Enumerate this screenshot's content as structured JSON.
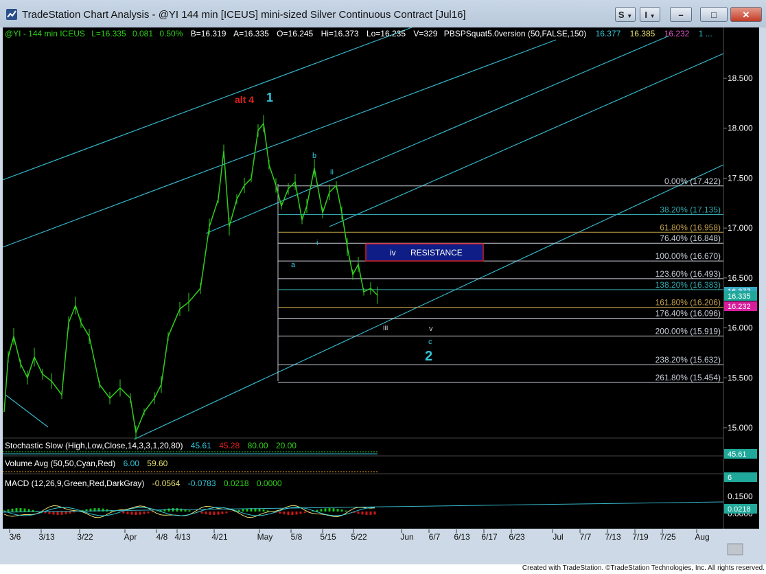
{
  "window": {
    "title": "TradeStation Chart Analysis - @YI 144 min [ICEUS] mini-sized Silver Continuous Contract [Jul16]",
    "buttons": {
      "s": "S",
      "i": "I"
    }
  },
  "header": {
    "symbol": "@YI - 144 min ICEUS",
    "last": "L=16.335",
    "change": "0.081",
    "pct": "0.50%",
    "bid": "B=16.319",
    "ask": "A=16.335",
    "open": "O=16.245",
    "high": "Hi=16.373",
    "low": "Lo=16.235",
    "volume": "V=329",
    "indicator": "PBSPSquat5.0version (50,FALSE,150)",
    "ind_v1": "16.377",
    "ind_v2": "16.385",
    "ind_v3": "16.232",
    "ind_v4": "1 ..."
  },
  "colors": {
    "price": "#2fd01a",
    "channel": "#35b6c8",
    "fib": "#c8cdd8",
    "resistance_fill": "#0f1d86",
    "resistance_border": "#d51d1d",
    "macd_hist_pos": "#19c219",
    "macd_hist_neg": "#d01717",
    "last_price_tag": "#20a89a",
    "pbs_tag": "#d61d9c"
  },
  "price_axis": [
    "18.500",
    "18.000",
    "17.500",
    "17.000",
    "16.500",
    "16.000",
    "15.500",
    "15.000"
  ],
  "price_tags": {
    "last": "16.335",
    "pbs": "16.232",
    "hidden": "16.377"
  },
  "fib_levels": [
    {
      "label": "0.00% (17.422)",
      "price": 17.422,
      "color": "#c8cdd8"
    },
    {
      "label": "38.20% (17.135)",
      "price": 17.135,
      "color": "#32a8ad"
    },
    {
      "label": "61.80% (16.958)",
      "price": 16.958,
      "color": "#c2a04a"
    },
    {
      "label": "76.40% (16.848)",
      "price": 16.848,
      "color": "#c8cdd8"
    },
    {
      "label": "100.00% (16.670)",
      "price": 16.67,
      "color": "#c8cdd8"
    },
    {
      "label": "123.60% (16.493)",
      "price": 16.493,
      "color": "#c8cdd8"
    },
    {
      "label": "138.20% (16.383)",
      "price": 16.383,
      "color": "#32a8ad"
    },
    {
      "label": "161.80% (16.206)",
      "price": 16.206,
      "color": "#c2a04a"
    },
    {
      "label": "176.40% (16.096)",
      "price": 16.096,
      "color": "#c8cdd8"
    },
    {
      "label": "200.00% (15.919)",
      "price": 15.919,
      "color": "#c8cdd8"
    },
    {
      "label": "238.20% (15.632)",
      "price": 15.632,
      "color": "#c8cdd8"
    },
    {
      "label": "261.80% (15.454)",
      "price": 15.454,
      "color": "#c8cdd8"
    }
  ],
  "resistance": {
    "wave": "iv",
    "label": "RESISTANCE"
  },
  "wave_labels": {
    "alt4": "alt 4",
    "one": "1",
    "a": "a",
    "b": "b",
    "i": "i",
    "ii": "ii",
    "iii": "iii",
    "v": "v",
    "c": "c",
    "two": "2"
  },
  "stochastic": {
    "label": "Stochastic Slow (High,Low,Close,14,3,3,1,20,80)",
    "v1": "45.61",
    "v2": "45.28",
    "v3": "80.00",
    "v4": "20.00",
    "tag": "45.61"
  },
  "volume_avg": {
    "label": "Volume Avg (50,50,Cyan,Red)",
    "v1": "6.00",
    "v2": "59.60",
    "tag": "6"
  },
  "macd": {
    "label": "MACD (12,26,9,Green,Red,DarkGray)",
    "v1": "-0.0564",
    "v2": "-0.0783",
    "v3": "0.0218",
    "v4": "0.0000",
    "axis": "0.1500",
    "tag": "0.0218",
    "hidden_axis": "0.0000"
  },
  "time_axis": [
    "3/6",
    "3/13",
    "3/22",
    "Apr",
    "4/8",
    "4/13",
    "4/21",
    "May",
    "5/8",
    "5/15",
    "5/22",
    "Jun",
    "6/7",
    "6/13",
    "6/17",
    "6/23",
    "Jul",
    "7/7",
    "7/13",
    "7/19",
    "7/25",
    "Aug"
  ],
  "status": {
    "credit": "Created with TradeStation. ©TradeStation Technologies, Inc. All rights reserved."
  }
}
